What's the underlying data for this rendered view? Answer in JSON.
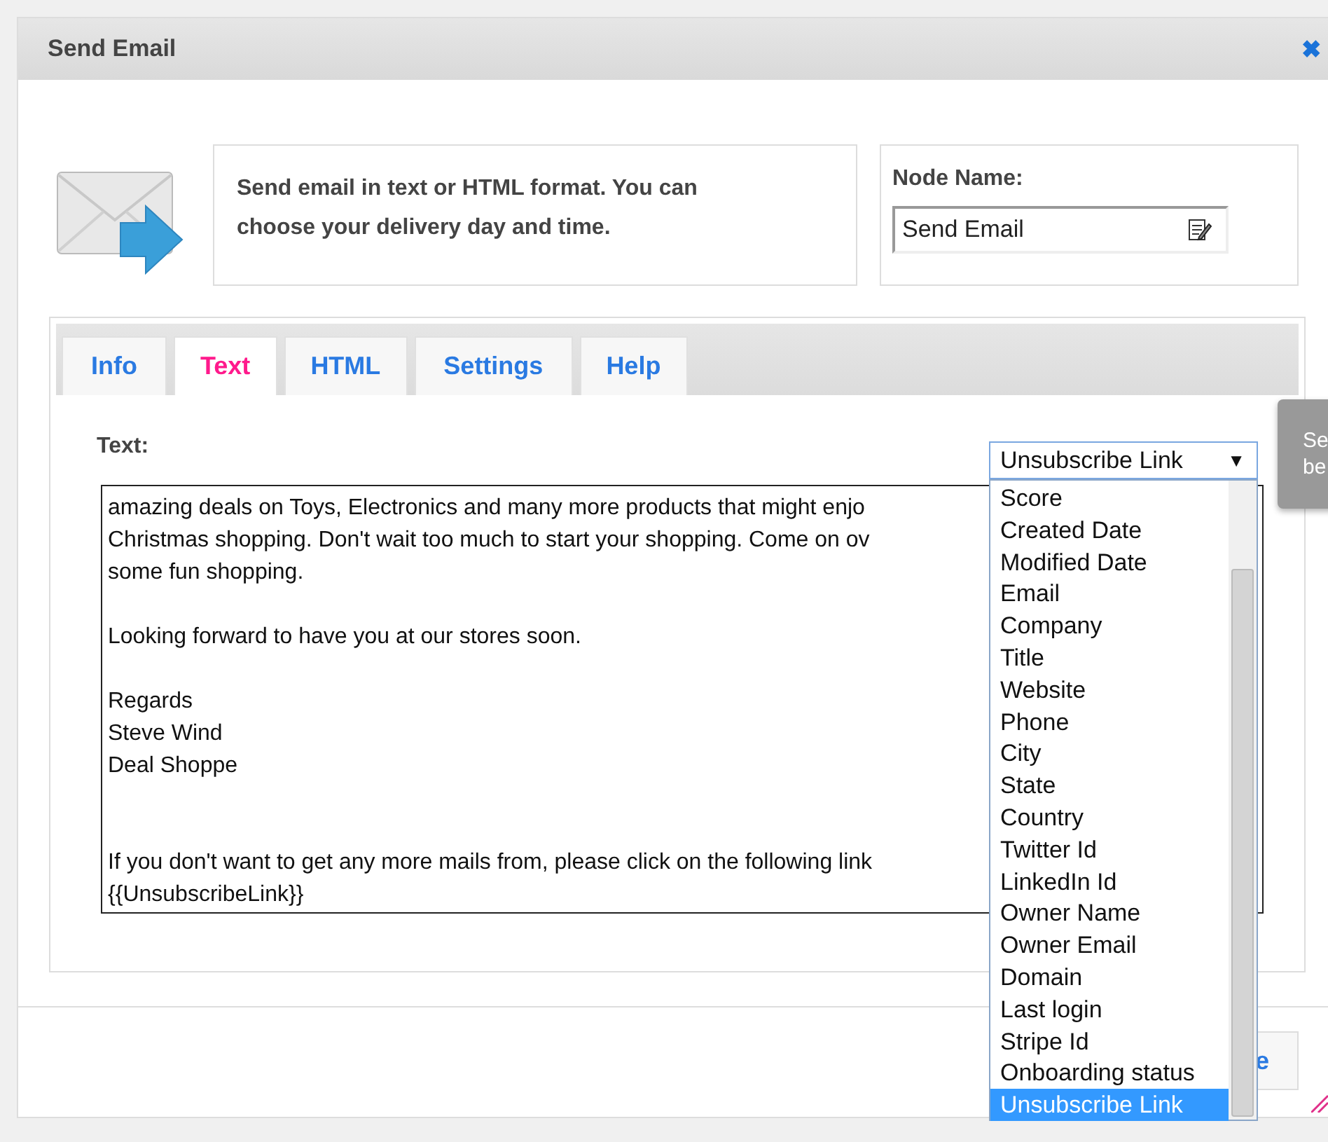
{
  "dialog": {
    "title": "Send Email",
    "close": "✖"
  },
  "intro": {
    "description": "Send email in text or HTML format. You can choose your delivery day and time.",
    "node_name_label": "Node Name:",
    "node_name_value": "Send Email"
  },
  "tabs": [
    {
      "label": "Info",
      "selected": false
    },
    {
      "label": "Text",
      "selected": true
    },
    {
      "label": "HTML",
      "selected": false
    },
    {
      "label": "Settings",
      "selected": false
    },
    {
      "label": "Help",
      "selected": false
    }
  ],
  "text_panel": {
    "label": "Text:",
    "paragraphs": [
      [
        "amazing deals on Toys, Electronics and many more products that might enjo",
        "Christmas shopping. Don't wait too much to start your shopping. Come on ov",
        "some fun shopping."
      ],
      [
        "Looking forward to have you at our stores soon."
      ],
      [
        "Regards",
        "Steve Wind",
        "Deal Shoppe"
      ],
      [
        "If you don't want to get any more mails from, please click on the following link",
        "{{UnsubscribeLink}}"
      ]
    ]
  },
  "field_select": {
    "value": "Unsubscribe Link",
    "arrow": "▼",
    "expanded": true,
    "options": [
      {
        "label": "Score",
        "selected": false
      },
      {
        "label": "Created Date",
        "selected": false
      },
      {
        "label": "Modified Date",
        "selected": false
      },
      {
        "label": "Email",
        "selected": false
      },
      {
        "label": "Company",
        "selected": false
      },
      {
        "label": "Title",
        "selected": false
      },
      {
        "label": "Website",
        "selected": false
      },
      {
        "label": "Phone",
        "selected": false
      },
      {
        "label": "City",
        "selected": false
      },
      {
        "label": "State",
        "selected": false
      },
      {
        "label": "Country",
        "selected": false
      },
      {
        "label": "Twitter Id",
        "selected": false
      },
      {
        "label": "LinkedIn Id",
        "selected": false
      },
      {
        "label": "Owner Name",
        "selected": false
      },
      {
        "label": "Owner Email",
        "selected": false
      },
      {
        "label": "Domain",
        "selected": false
      },
      {
        "label": "Last login",
        "selected": false
      },
      {
        "label": "Stripe Id",
        "selected": false
      },
      {
        "label": "Onboarding status",
        "selected": false
      },
      {
        "label": "Unsubscribe Link",
        "selected": true
      }
    ]
  },
  "tooltip": {
    "lines": [
      "Se",
      "be"
    ]
  },
  "footer": {
    "button": "e"
  }
}
